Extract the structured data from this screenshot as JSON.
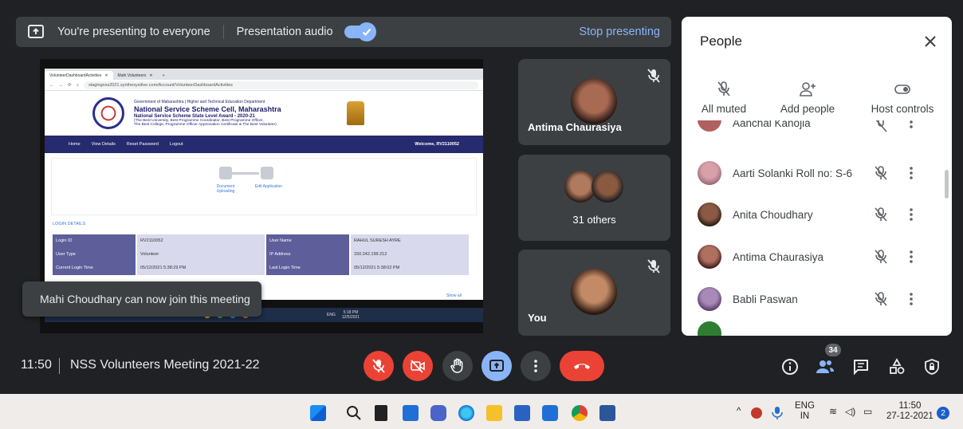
{
  "presenting_bar": {
    "message": "You're presenting to everyone",
    "audio_label": "Presentation audio",
    "audio_enabled": true,
    "stop_label": "Stop presenting"
  },
  "shared_screen": {
    "tabs": [
      "VolunteerDashboardActivities",
      "Mahi Volunteers"
    ],
    "url": "stagingnss2021.synthesysitive.com/Account/VolunteerDashboardActivities",
    "header_line1": "Government of Maharashtra | Higher and Technical Education Department",
    "header_title": "National Service Scheme Cell, Maharashtra",
    "header_subtitle": "National Service Scheme State Level Award - 2020-21",
    "header_line3": "(The Best University, Best Programme Coordinator, Best Programme Officer,",
    "header_line4": "The Best College, Programme Officer Appreciation Certificate & The Best Volunteer)",
    "nav": [
      "Home",
      "View Details",
      "Reset Password",
      "Logout"
    ],
    "welcome": "Welcome, RV2110052",
    "steps": [
      "Document Uploading",
      "Edit Application"
    ],
    "login_title": "LOGIN DETAILS",
    "login_rows": [
      {
        "k1": "Login ID",
        "v1": "RV2110052",
        "k2": "User Name",
        "v2": "RAHUL SURESH AYRE"
      },
      {
        "k1": "User Type",
        "v1": "Volunteer",
        "k2": "IP Address",
        "v2": "150.242.199.212"
      },
      {
        "k1": "Current Login Time",
        "v1": "05/12/2021 5:38:29 PM",
        "k2": "Last Login Time",
        "v2": "05/12/2021 5:38:02 PM"
      }
    ],
    "show_all": "Show all",
    "mini_tray": "ENG",
    "mini_time": "5:18 PM",
    "mini_date": "12/5/2021"
  },
  "toast": {
    "message": "Mahi Choudhary can now join this meeting"
  },
  "tiles": [
    {
      "name": "Antima Chaurasiya",
      "muted": true
    },
    {
      "name": "31 others"
    },
    {
      "name": "You",
      "muted": true
    }
  ],
  "people_panel": {
    "title": "People",
    "actions": [
      {
        "label": "All muted",
        "icon": "mic-off-icon"
      },
      {
        "label": "Add people",
        "icon": "person-add-icon"
      },
      {
        "label": "Host controls",
        "icon": "toggle-icon"
      }
    ],
    "participants": [
      {
        "name": "Aanchal Kanojia",
        "color": "#b06060"
      },
      {
        "name": "Aarti Solanki Roll no: S-6",
        "color": "#c48a9c"
      },
      {
        "name": "Anita Choudhary",
        "color": "#5a3a2a"
      },
      {
        "name": "Antima Chaurasiya",
        "color": "#a0524a"
      },
      {
        "name": "Babli Paswan",
        "color": "#8a6a9a"
      },
      {
        "name": "",
        "color": "#2e7d32"
      }
    ]
  },
  "bottom_bar": {
    "time": "11:50",
    "meeting_name": "NSS Volunteers Meeting 2021-22",
    "people_count": "34"
  },
  "windows_taskbar": {
    "lang_top": "ENG",
    "lang_bottom": "IN",
    "time": "11:50",
    "date": "27-12-2021",
    "notifications": "2"
  },
  "colors": {
    "background": "#202124",
    "accent": "#8ab4f8",
    "danger": "#ea4335",
    "panel": "#ffffff"
  }
}
